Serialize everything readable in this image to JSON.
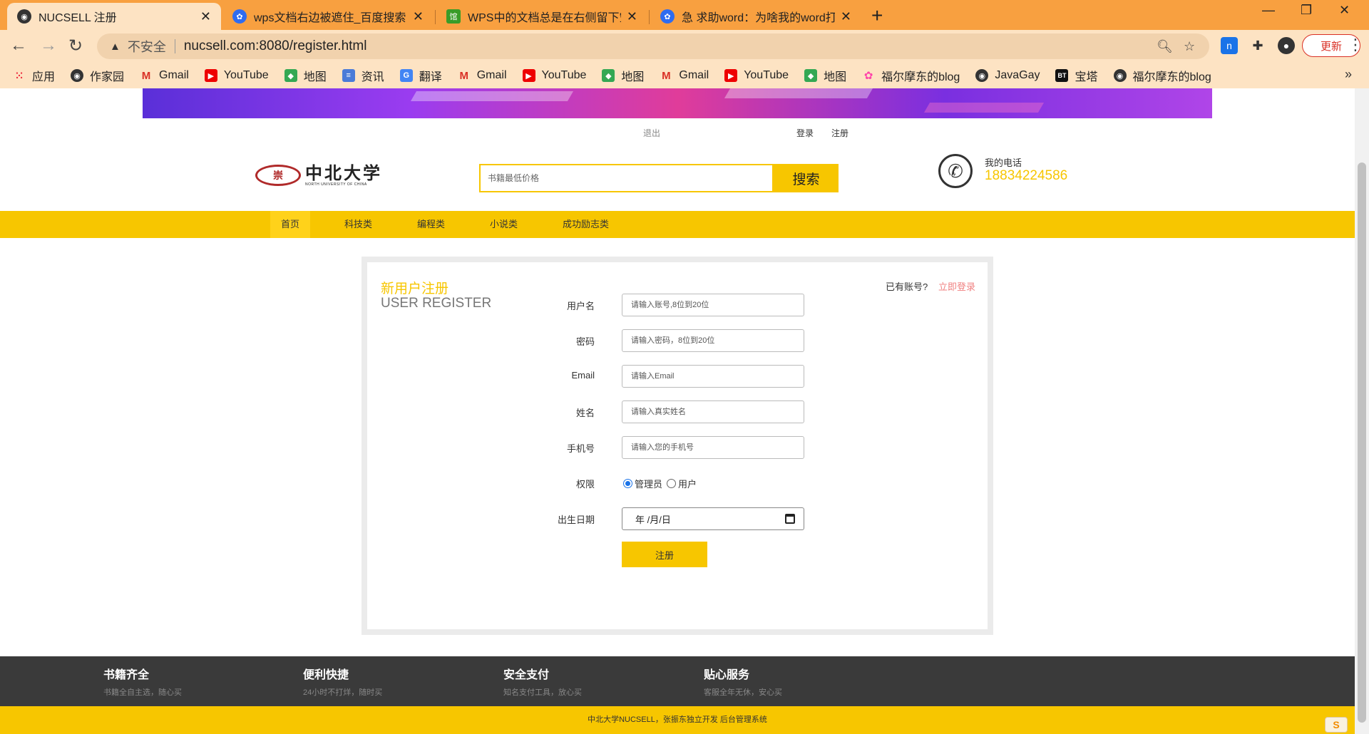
{
  "browser": {
    "tabs": [
      {
        "title": "NUCSELL 注册",
        "active": true
      },
      {
        "title": "wps文档右边被遮住_百度搜索",
        "active": false
      },
      {
        "title": "WPS中的文档总是在右侧留下空白",
        "active": false
      },
      {
        "title": "急 求助word：为啥我的word打开",
        "active": false
      }
    ],
    "new_tab": "+",
    "window_controls": {
      "minimize": "—",
      "restore": "❐",
      "close": "✕"
    },
    "address": {
      "security_label": "不安全",
      "url": "nucsell.com:8080/register.html"
    },
    "update_label": "更新",
    "bookmarks": [
      {
        "label": "应用",
        "icon": "apps-grid-icon"
      },
      {
        "label": "作家园",
        "icon": "globe-icon"
      },
      {
        "label": "Gmail",
        "icon": "gmail-icon"
      },
      {
        "label": "YouTube",
        "icon": "youtube-icon"
      },
      {
        "label": "地图",
        "icon": "maps-icon"
      },
      {
        "label": "资讯",
        "icon": "news-icon"
      },
      {
        "label": "翻译",
        "icon": "translate-icon"
      },
      {
        "label": "Gmail",
        "icon": "gmail-icon"
      },
      {
        "label": "YouTube",
        "icon": "youtube-icon"
      },
      {
        "label": "地图",
        "icon": "maps-icon"
      },
      {
        "label": "Gmail",
        "icon": "gmail-icon"
      },
      {
        "label": "YouTube",
        "icon": "youtube-icon"
      },
      {
        "label": "地图",
        "icon": "maps-icon"
      },
      {
        "label": "福尔摩东的blog",
        "icon": "flower-icon"
      },
      {
        "label": "JavaGay",
        "icon": "globe-icon"
      },
      {
        "label": "宝塔",
        "icon": "bt-icon"
      },
      {
        "label": "福尔摩东的blog",
        "icon": "globe-icon"
      }
    ]
  },
  "page": {
    "top_links": {
      "logout": "退出",
      "login": "登录",
      "register": "注册"
    },
    "logo": {
      "seal": "崇",
      "name_cn": "中北大学",
      "name_en": "NORTH UNIVERSITY OF CHINA"
    },
    "search": {
      "placeholder": "书籍最低价格",
      "button": "搜索"
    },
    "contact": {
      "label": "我的电话",
      "phone": "18834224586"
    },
    "nav": [
      "首页",
      "科技类",
      "编程类",
      "小说类",
      "成功励志类"
    ],
    "register": {
      "title_cn": "新用户注册",
      "title_en": "USER REGISTER",
      "have_account": "已有账号?",
      "login_now": "立即登录",
      "fields": [
        {
          "label": "用户名",
          "placeholder": "请输入账号,8位到20位"
        },
        {
          "label": "密码",
          "placeholder": "请输入密码，8位到20位"
        },
        {
          "label": "Email",
          "placeholder": "请输入Email"
        },
        {
          "label": "姓名",
          "placeholder": "请输入真实姓名"
        },
        {
          "label": "手机号",
          "placeholder": "请输入您的手机号"
        }
      ],
      "role_label": "权限",
      "roles": [
        {
          "label": "管理员",
          "checked": true
        },
        {
          "label": "用户",
          "checked": false
        }
      ],
      "birth_label": "出生日期",
      "birth_value": "年 /月/日",
      "submit": "注册"
    },
    "features": [
      {
        "title": "书籍齐全",
        "sub": "书籍全自主选，随心买"
      },
      {
        "title": "便利快捷",
        "sub": "24小时不打烊，随时买"
      },
      {
        "title": "安全支付",
        "sub": "知名支付工具，放心买"
      },
      {
        "title": "贴心服务",
        "sub": "客服全年无休，安心买"
      }
    ],
    "footer": {
      "text": "中北大学NUCSELL，张振东独立开发",
      "admin_link": "后台管理系统"
    }
  },
  "colors": {
    "brand_yellow": "#f7c600",
    "tab_bar": "#f8a040",
    "toolbar": "#fde3c3",
    "login_link": "#f08080",
    "footer_dark": "#3a3a3a"
  }
}
